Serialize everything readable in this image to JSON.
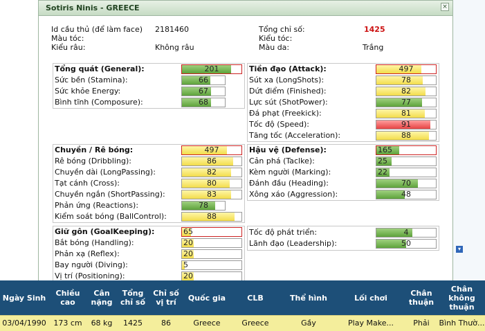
{
  "popup": {
    "title": "Sotiris Ninis - GREECE",
    "close_symbol": "×"
  },
  "info": {
    "id_label": "Id cầu thủ (để làm face)",
    "id_value": "2181460",
    "hair_color_label": "Màu tóc:",
    "beard_label": "Kiểu râu:",
    "beard_value": "Không râu",
    "total_label": "Tổng chỉ số:",
    "total_value": "1425",
    "hairstyle_label": "Kiểu tóc:",
    "skin_label": "Màu da:",
    "skin_value": "Trắng"
  },
  "general": {
    "header": {
      "label": "Tổng quát (General):",
      "value": 201,
      "pct": 0.82
    },
    "items": [
      {
        "label": "Sức bền (Stamina):",
        "value": 66,
        "pct": 0.66
      },
      {
        "label": "Sức khỏe Energy:",
        "value": 67,
        "pct": 0.67
      },
      {
        "label": "Bình tĩnh (Composure):",
        "value": 68,
        "pct": 0.68
      }
    ]
  },
  "attack": {
    "header": {
      "label": "Tiền đạo (Attack):",
      "value": 497,
      "pct": 0.75
    },
    "items": [
      {
        "label": "Sút xa (LongShots):",
        "value": 78,
        "pct": 0.78
      },
      {
        "label": "Dứt điểm (Finished):",
        "value": 82,
        "pct": 0.82
      },
      {
        "label": "Lực sút (ShotPower):",
        "value": 77,
        "pct": 0.77
      },
      {
        "label": "Đá phạt (Freekick):",
        "value": 81,
        "pct": 0.81
      },
      {
        "label": "Tốc độ (Speed):",
        "value": 91,
        "pct": 0.91
      },
      {
        "label": "Tăng tốc (Acceleration):",
        "value": 88,
        "pct": 0.88
      }
    ]
  },
  "dribbling": {
    "header": {
      "label": "Chuyền / Rê bóng:",
      "value": 497,
      "pct": 0.75
    },
    "items": [
      {
        "label": "Rê bóng (Dribbling):",
        "value": 86,
        "pct": 0.86
      },
      {
        "label": "Chuyền dài (LongPassing):",
        "value": 82,
        "pct": 0.82
      },
      {
        "label": "Tạt cánh (Cross):",
        "value": 80,
        "pct": 0.8
      },
      {
        "label": "Chuyền ngắn (ShortPassing):",
        "value": 83,
        "pct": 0.83
      },
      {
        "label": "Phản ứng (Reactions):",
        "value": 78,
        "pct": 0.78
      },
      {
        "label": "Kiểm soát bóng (BallControl):",
        "value": 88,
        "pct": 0.88
      }
    ]
  },
  "defense": {
    "header": {
      "label": "Hậu vệ (Defense):",
      "value": 165,
      "pct": 0.38
    },
    "items": [
      {
        "label": "Cản phá (Taclke):",
        "value": 25,
        "pct": 0.25
      },
      {
        "label": "Kèm người (Marking):",
        "value": 22,
        "pct": 0.22
      },
      {
        "label": "Đánh đầu (Heading):",
        "value": 70,
        "pct": 0.7
      },
      {
        "label": "Xông xáo (Aggression):",
        "value": 48,
        "pct": 0.48
      }
    ]
  },
  "goalkeeping": {
    "header": {
      "label": "Giữ gôn (GoalKeeping):",
      "value": 65,
      "pct": 0.15
    },
    "items": [
      {
        "label": "Bắt bóng (Handling):",
        "value": 20,
        "pct": 0.2
      },
      {
        "label": "Phản xạ (Reflex):",
        "value": 20,
        "pct": 0.2
      },
      {
        "label": "Bay người (Diving):",
        "value": 5,
        "pct": 0.05
      },
      {
        "label": "Vị trí (Positioning):",
        "value": 20,
        "pct": 0.2
      }
    ]
  },
  "other": {
    "items": [
      {
        "label": "Tốc độ phát triển:",
        "value": 4,
        "pct": 0.6
      },
      {
        "label": "Lãnh đạo (Leadership):",
        "value": 50,
        "pct": 0.5
      }
    ]
  },
  "colors": {
    "total_red": "#cc1111",
    "table_header": "#1d4f78",
    "table_row": "#f4ee9c"
  },
  "table": {
    "headers": [
      "Ngày Sinh",
      "Chiều\ncao",
      "Cân\nnặng",
      "Tổng\nchỉ số",
      "Chỉ số\nvị trí",
      "Quốc gia",
      "CLB",
      "Thể hình",
      "Lối chơi",
      "Chân\nthuận",
      "Chân\nkhông\nthuận"
    ],
    "row": [
      "03/04/1990",
      "173 cm",
      "68 kg",
      "1425",
      "86",
      "Greece",
      "Greece",
      "Gầy",
      "Play Make...",
      "Phải",
      "Bình Thườ..."
    ]
  }
}
